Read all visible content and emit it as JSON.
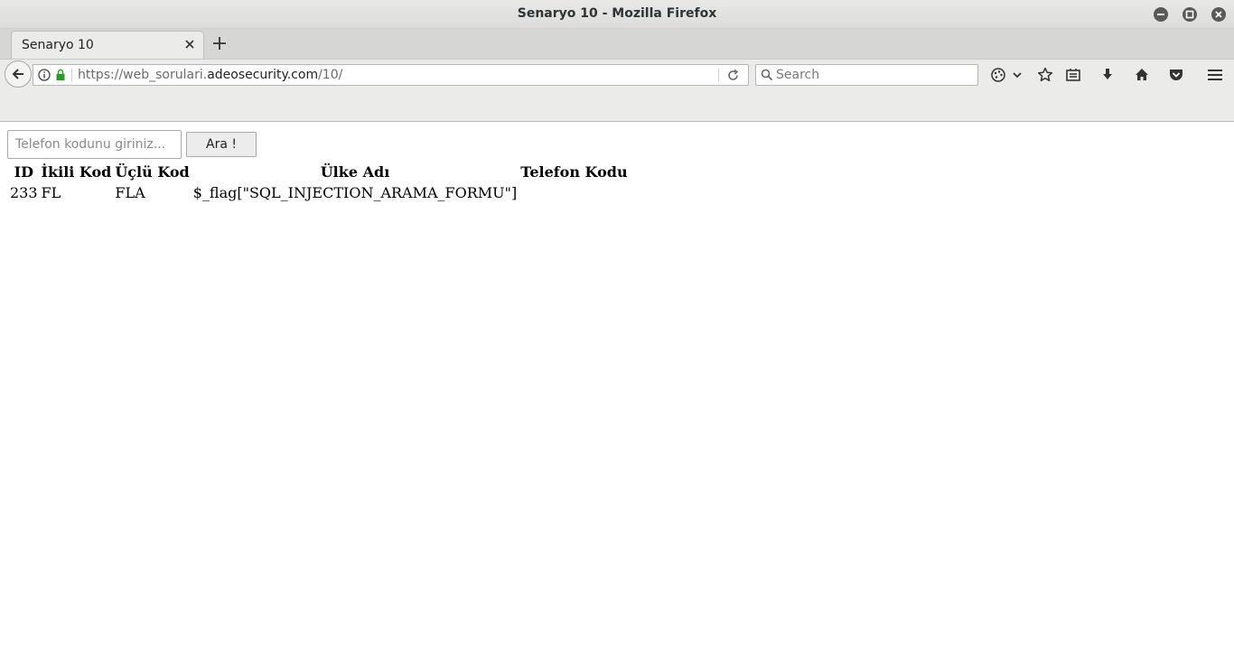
{
  "window": {
    "title": "Senaryo 10 - Mozilla Firefox"
  },
  "tabs": [
    {
      "label": "Senaryo 10",
      "active": true
    }
  ],
  "navbar": {
    "url_prefix": "https://web_sorulari.",
    "url_domain": "adeosecurity.com",
    "url_path": "/10/",
    "search_placeholder": "Search"
  },
  "page": {
    "input_placeholder": "Telefon kodunu giriniz...",
    "button_label": "Ara !",
    "table": {
      "headers": [
        "ID",
        "İkili Kod",
        "Üçlü Kod",
        "Ülke Adı",
        "Telefon Kodu"
      ],
      "rows": [
        [
          "233",
          "FL",
          "FLA",
          "$_flag[\"SQL_INJECTION_ARAMA_FORMU\"]",
          ""
        ]
      ]
    }
  },
  "colors": {
    "chrome_bg": "#ebebea",
    "tabstrip_bg": "#d6d6d5",
    "lock_green": "#2b9a2b"
  },
  "icons": [
    "minimize-icon",
    "maximize-icon",
    "close-icon",
    "tab-close-icon",
    "new-tab-icon",
    "back-arrow-icon",
    "info-icon",
    "lock-icon",
    "reload-icon",
    "search-icon",
    "sync-icon",
    "dropdown-icon",
    "bookmark-star-icon",
    "reading-list-icon",
    "download-icon",
    "home-icon",
    "pocket-icon",
    "menu-icon"
  ]
}
